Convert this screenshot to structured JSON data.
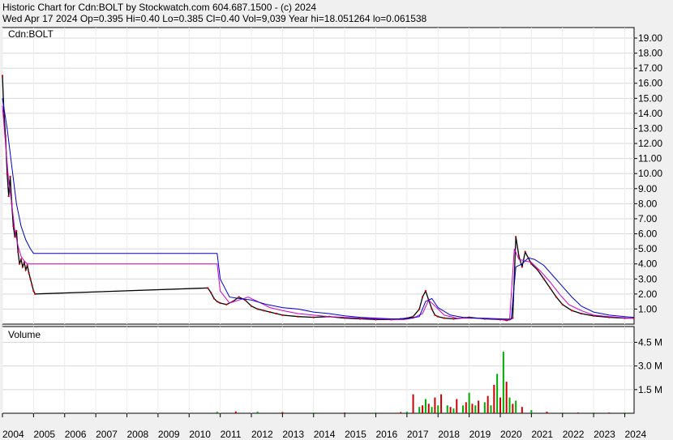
{
  "header": {
    "line1": "Historic Chart for Cdn:BOLT by Stockwatch.com 604.687.1500 - (c) 2024",
    "line2": "Wed Apr 17 2024   Op=0.395   Hi=0.40   Lo=0.385   Cl=0.40   Vol=9,039   Year hi=18.051264   lo=0.061538"
  },
  "colors": {
    "background": "#f0f0f0",
    "plot_bg": "#ffffff",
    "price_bar": "#000000",
    "down_bar": "#cc0000",
    "ma_short": "#cc00cc",
    "ma_long": "#0000cc",
    "vol_up": "#00aa00",
    "vol_down": "#cc0000"
  },
  "chart_data": [
    {
      "type": "line",
      "panel": "price",
      "label": "Cdn:BOLT",
      "y_ticks": [
        "19.00",
        "18.00",
        "17.00",
        "16.00",
        "15.00",
        "14.00",
        "13.00",
        "12.00",
        "11.00",
        "10.00",
        "9.00",
        "8.00",
        "7.00",
        "6.00",
        "5.00",
        "4.00",
        "3.00",
        "2.00",
        "1.00"
      ],
      "ylim": [
        0,
        19.7
      ],
      "x_ticks": [
        "2004",
        "2005",
        "2006",
        "2007",
        "2008",
        "2009",
        "2010",
        "2011",
        "2012",
        "2013",
        "2014",
        "2015",
        "2016",
        "2017",
        "2018",
        "2019",
        "2020",
        "2021",
        "2022",
        "2023",
        "2024"
      ],
      "xlim": [
        2004.0,
        2024.3
      ],
      "grid": true,
      "series": [
        {
          "role": "price",
          "x": [
            2004.0,
            2004.05,
            2004.1,
            2004.15,
            2004.2,
            2004.25,
            2004.3,
            2004.35,
            2004.4,
            2004.45,
            2004.5,
            2004.55,
            2004.6,
            2004.65,
            2004.7,
            2004.75,
            2004.8,
            2004.85,
            2004.9,
            2004.95,
            2005.0,
            2005.05,
            2010.6,
            2010.7,
            2010.8,
            2010.9,
            2011.0,
            2011.2,
            2011.4,
            2011.6,
            2011.8,
            2012.0,
            2012.2,
            2012.4,
            2012.6,
            2012.8,
            2013.0,
            2013.5,
            2014.0,
            2014.5,
            2015.0,
            2015.5,
            2016.0,
            2016.5,
            2016.8,
            2017.0,
            2017.2,
            2017.4,
            2017.5,
            2017.6,
            2017.7,
            2017.8,
            2017.9,
            2018.0,
            2018.2,
            2018.5,
            2019.0,
            2019.5,
            2020.0,
            2020.1,
            2020.2,
            2020.3,
            2020.4,
            2020.5,
            2020.6,
            2020.7,
            2020.8,
            2020.9,
            2021.0,
            2021.2,
            2021.4,
            2021.6,
            2021.8,
            2022.0,
            2022.3,
            2022.6,
            2023.0,
            2023.5,
            2024.0,
            2024.29
          ],
          "y": [
            16.5,
            14.0,
            12.5,
            10.0,
            8.5,
            9.8,
            8.0,
            6.5,
            5.8,
            6.2,
            4.8,
            4.0,
            4.3,
            3.8,
            4.1,
            3.6,
            3.9,
            3.4,
            3.0,
            2.6,
            2.2,
            2.0,
            2.4,
            2.1,
            1.7,
            1.5,
            1.4,
            1.3,
            1.5,
            1.8,
            1.6,
            1.2,
            1.0,
            0.9,
            0.8,
            0.7,
            0.6,
            0.5,
            0.45,
            0.5,
            0.4,
            0.35,
            0.3,
            0.3,
            0.35,
            0.4,
            0.5,
            1.0,
            1.8,
            2.2,
            1.6,
            1.0,
            0.6,
            0.5,
            0.4,
            0.35,
            0.45,
            0.35,
            0.3,
            0.3,
            0.25,
            0.3,
            0.4,
            5.8,
            4.5,
            3.8,
            4.8,
            4.4,
            4.0,
            3.6,
            3.0,
            2.4,
            1.8,
            1.3,
            0.9,
            0.7,
            0.55,
            0.45,
            0.4,
            0.4
          ]
        },
        {
          "role": "ma_short",
          "x": [
            2004.0,
            2004.1,
            2004.2,
            2004.3,
            2004.4,
            2004.5,
            2004.6,
            2004.7,
            2004.8,
            2004.9,
            2005.0,
            2010.9,
            2011.0,
            2011.3,
            2011.6,
            2011.9,
            2012.2,
            2012.6,
            2013.0,
            2013.5,
            2014.0,
            2014.5,
            2015.0,
            2015.5,
            2016.0,
            2016.5,
            2016.9,
            2017.2,
            2017.5,
            2017.7,
            2017.9,
            2018.2,
            2018.6,
            2019.0,
            2019.5,
            2020.0,
            2020.3,
            2020.45,
            2020.6,
            2020.8,
            2021.0,
            2021.3,
            2021.6,
            2021.9,
            2022.2,
            2022.6,
            2023.0,
            2023.5,
            2024.0,
            2024.29
          ],
          "y": [
            14.5,
            12.0,
            9.5,
            8.0,
            6.2,
            5.2,
            4.5,
            4.2,
            4.0,
            4.0,
            4.0,
            4.0,
            2.2,
            1.4,
            1.6,
            1.8,
            1.5,
            1.1,
            0.9,
            0.7,
            0.6,
            0.5,
            0.45,
            0.4,
            0.35,
            0.3,
            0.3,
            0.4,
            0.7,
            1.6,
            1.2,
            0.6,
            0.4,
            0.4,
            0.38,
            0.3,
            0.3,
            5.0,
            4.3,
            4.2,
            4.1,
            3.5,
            2.8,
            2.0,
            1.3,
            0.9,
            0.6,
            0.5,
            0.42,
            0.4
          ]
        },
        {
          "role": "ma_long",
          "x": [
            2004.0,
            2004.15,
            2004.3,
            2004.45,
            2004.6,
            2004.75,
            2004.9,
            2005.0,
            2010.9,
            2011.0,
            2011.3,
            2011.6,
            2012.0,
            2012.5,
            2013.0,
            2013.5,
            2014.0,
            2014.5,
            2015.0,
            2015.5,
            2016.0,
            2016.5,
            2017.0,
            2017.4,
            2017.6,
            2017.8,
            2018.0,
            2018.4,
            2018.8,
            2019.2,
            2019.6,
            2020.0,
            2020.35,
            2020.5,
            2020.7,
            2020.9,
            2021.1,
            2021.4,
            2021.7,
            2022.0,
            2022.3,
            2022.6,
            2023.0,
            2023.5,
            2024.0,
            2024.29
          ],
          "y": [
            15.0,
            13.0,
            10.5,
            8.0,
            6.5,
            5.6,
            5.0,
            4.7,
            4.7,
            3.0,
            1.8,
            1.7,
            1.6,
            1.3,
            1.1,
            1.0,
            0.8,
            0.7,
            0.55,
            0.45,
            0.4,
            0.35,
            0.35,
            0.5,
            1.5,
            1.7,
            1.1,
            0.6,
            0.45,
            0.4,
            0.38,
            0.35,
            0.33,
            3.8,
            4.0,
            4.4,
            4.3,
            3.9,
            3.2,
            2.5,
            1.8,
            1.2,
            0.8,
            0.6,
            0.5,
            0.45
          ]
        }
      ]
    },
    {
      "type": "bar",
      "panel": "volume",
      "label": "Volume",
      "y_ticks": [
        "4.5 M",
        "3.0 M",
        "1.5 M"
      ],
      "ylim": [
        0,
        5.5
      ],
      "grid": true,
      "series": [
        {
          "role": "volume",
          "x": [
            2010.9,
            2011.5,
            2012.2,
            2013.0,
            2014.0,
            2015.0,
            2016.0,
            2016.8,
            2017.0,
            2017.2,
            2017.4,
            2017.5,
            2017.6,
            2017.7,
            2017.8,
            2017.9,
            2018.0,
            2018.1,
            2018.3,
            2018.4,
            2018.5,
            2018.6,
            2018.8,
            2018.9,
            2019.0,
            2019.1,
            2019.2,
            2019.3,
            2019.5,
            2019.6,
            2019.7,
            2019.8,
            2019.9,
            2020.0,
            2020.1,
            2020.2,
            2020.3,
            2020.4,
            2020.5,
            2020.7,
            2021.0,
            2021.5,
            2022.0,
            2022.5,
            2023.0,
            2023.5,
            2024.0
          ],
          "y": [
            0.1,
            0.12,
            0.1,
            0.08,
            0.05,
            0.05,
            0.05,
            0.08,
            0.1,
            1.2,
            0.4,
            0.5,
            0.9,
            0.6,
            0.4,
            1.0,
            0.5,
            1.2,
            0.5,
            0.4,
            0.3,
            0.9,
            0.5,
            0.7,
            1.3,
            0.6,
            0.5,
            0.8,
            0.7,
            1.1,
            0.5,
            1.8,
            2.5,
            1.0,
            3.9,
            2.0,
            1.0,
            0.6,
            0.8,
            0.4,
            0.2,
            0.1,
            0.05,
            0.05,
            0.05,
            0.05,
            0.05
          ]
        }
      ]
    }
  ]
}
